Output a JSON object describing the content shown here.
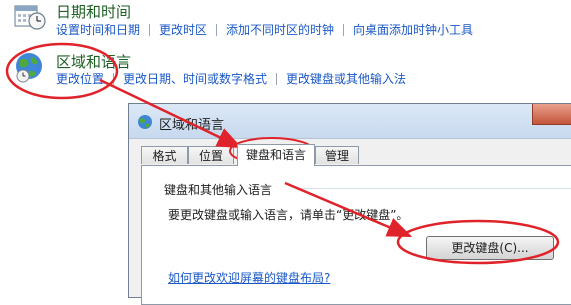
{
  "control_panel": {
    "datetime": {
      "icon": "calendar-clock-icon",
      "heading": "日期和时间",
      "links": [
        "设置时间和日期",
        "更改时区",
        "添加不同时区的时钟",
        "向桌面添加时钟小工具"
      ]
    },
    "region": {
      "icon": "globe-clock-icon",
      "heading": "区域和语言",
      "links": [
        "更改位置",
        "更改日期、时间或数字格式",
        "更改键盘或其他输入法"
      ]
    }
  },
  "dialog": {
    "title": "区域和语言",
    "title_icon": "globe-icon",
    "tabs": [
      "格式",
      "位置",
      "键盘和语言",
      "管理"
    ],
    "active_tab": "键盘和语言",
    "group_title": "键盘和其他输入语言",
    "description": "要更改键盘或输入语言，请单击“更改键盘”。",
    "change_keyboard_button": "更改键盘(C)...",
    "help_link": "如何更改欢迎屏幕的键盘布局?"
  },
  "annotation_color": "#e0232a"
}
